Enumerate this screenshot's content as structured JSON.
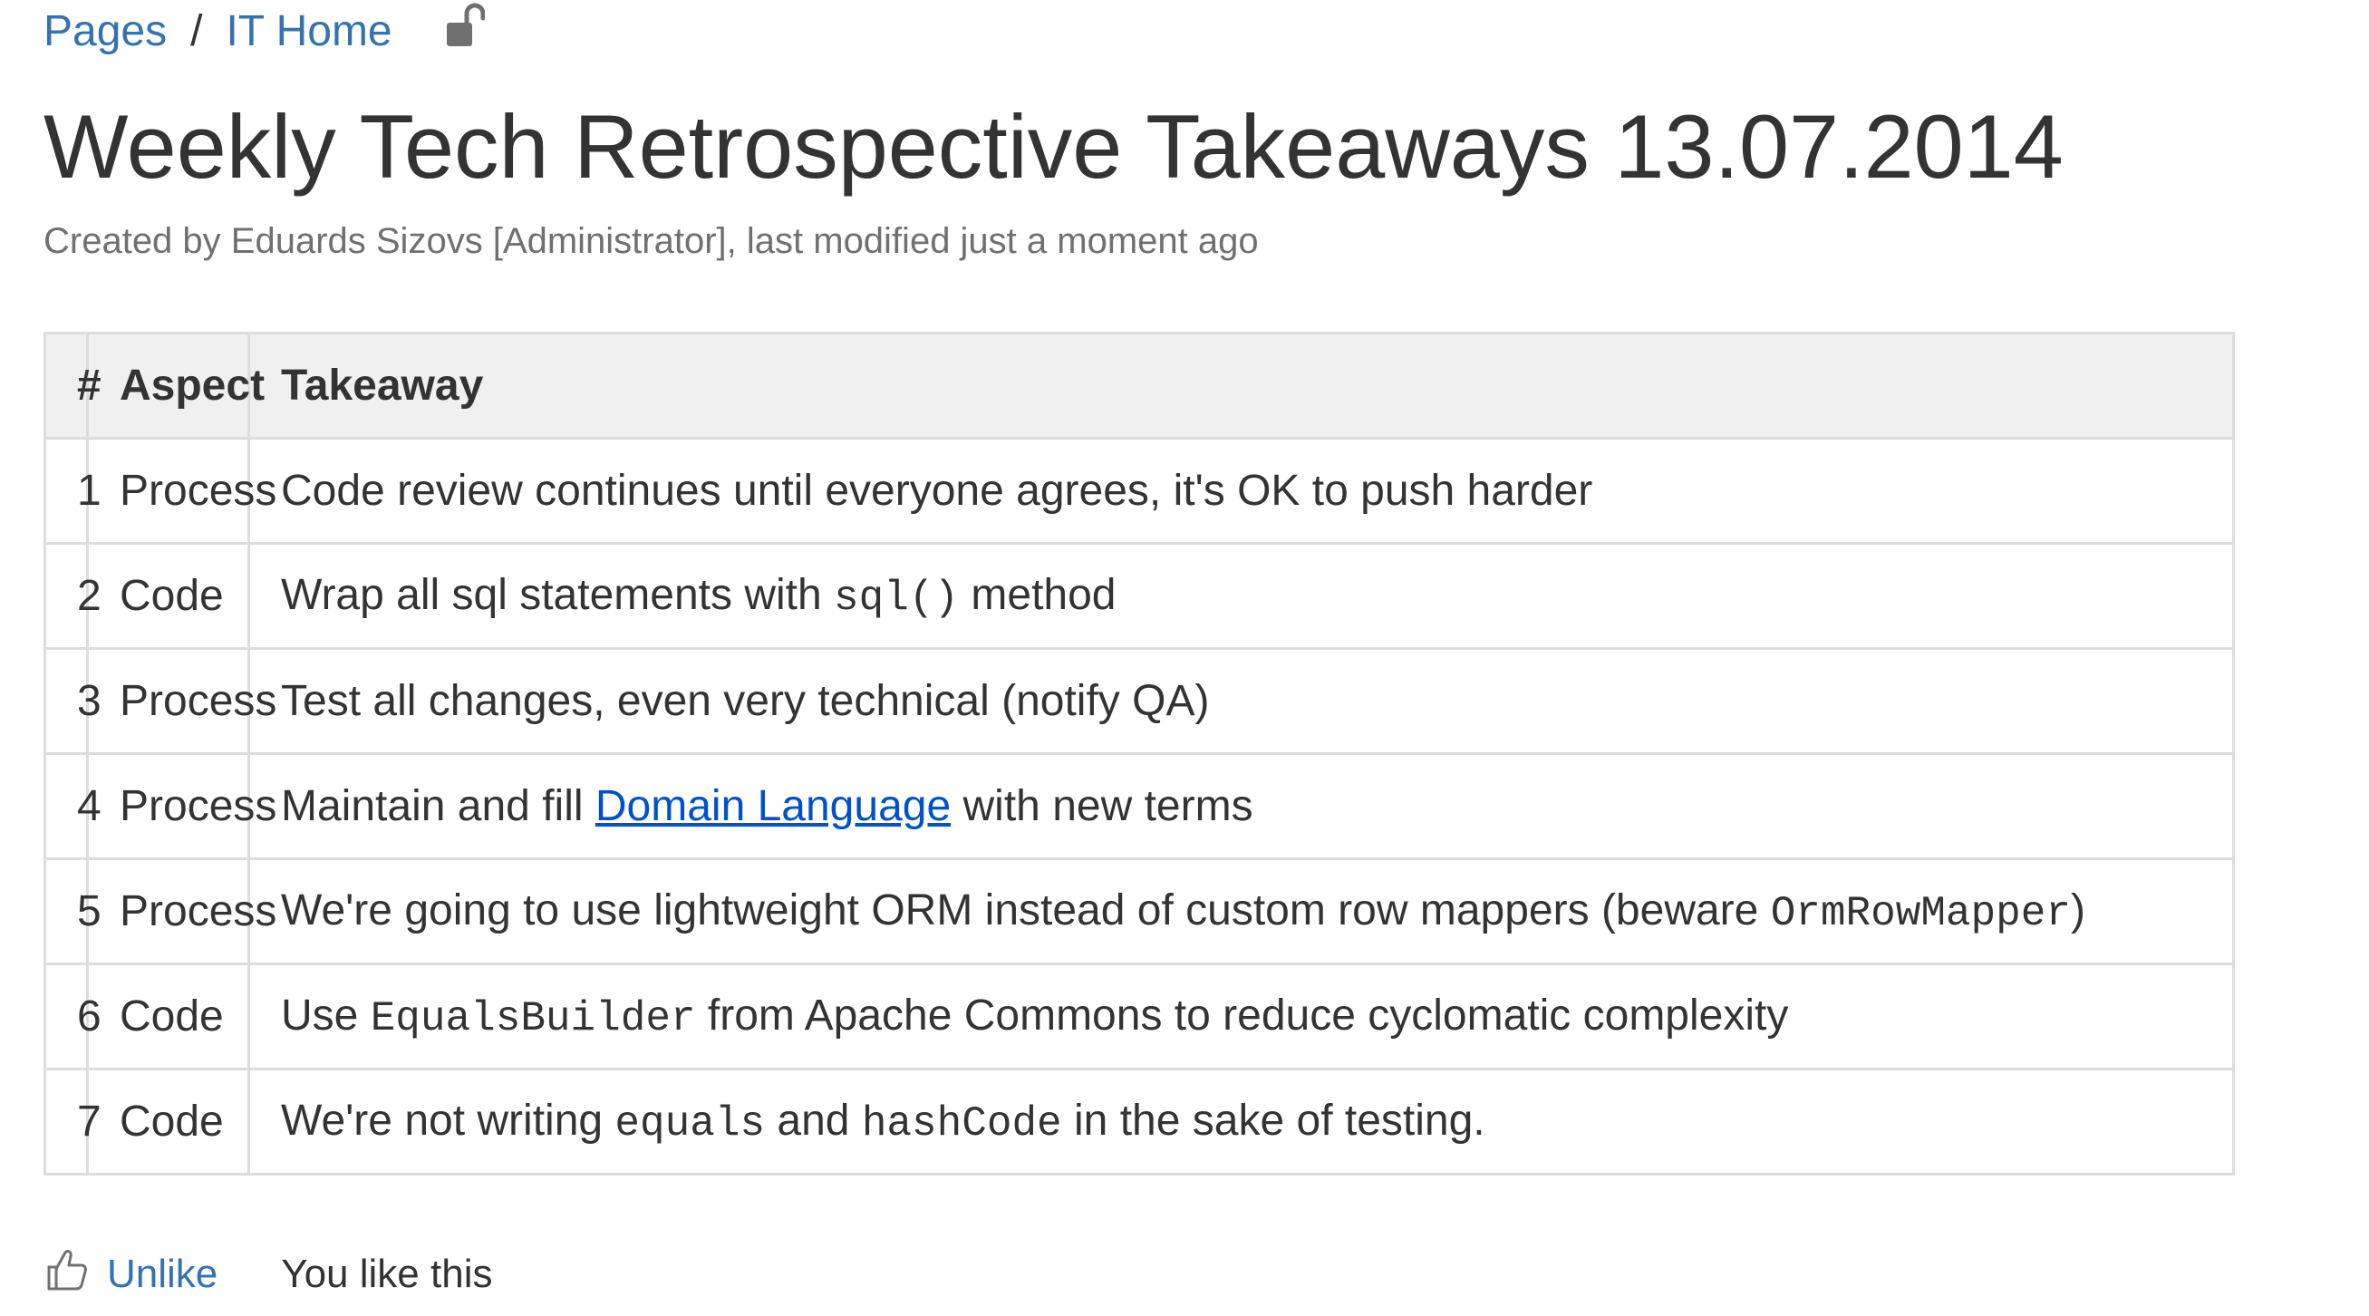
{
  "breadcrumb": {
    "items": [
      "Pages",
      "IT Home"
    ],
    "separator": "/"
  },
  "page": {
    "title": "Weekly Tech Retrospective Takeaways 13.07.2014",
    "meta": {
      "prefix": "Created by ",
      "author": "Eduards Sizovs [Administrator]",
      "suffix": ", last modified just a moment ago"
    }
  },
  "table": {
    "headers": [
      "#",
      "Aspect",
      "Takeaway"
    ],
    "rows": [
      {
        "num": "1",
        "aspect": "Process",
        "takeaway": [
          {
            "t": "text",
            "v": "Code review continues until everyone agrees, it's OK to push harder"
          }
        ]
      },
      {
        "num": "2",
        "aspect": "Code",
        "takeaway": [
          {
            "t": "text",
            "v": "Wrap all sql statements with "
          },
          {
            "t": "code",
            "v": "sql()"
          },
          {
            "t": "text",
            "v": " method"
          }
        ]
      },
      {
        "num": "3",
        "aspect": "Process",
        "takeaway": [
          {
            "t": "text",
            "v": "Test all changes, even very technical (notify QA)"
          }
        ]
      },
      {
        "num": "4",
        "aspect": "Process",
        "takeaway": [
          {
            "t": "text",
            "v": "Maintain and fill "
          },
          {
            "t": "link",
            "v": "Domain Language"
          },
          {
            "t": "text",
            "v": " with new terms"
          }
        ]
      },
      {
        "num": "5",
        "aspect": "Process",
        "takeaway": [
          {
            "t": "text",
            "v": "We're going to use lightweight ORM instead of custom row mappers (beware "
          },
          {
            "t": "code",
            "v": "OrmRowMapper"
          },
          {
            "t": "text",
            "v": ")"
          }
        ]
      },
      {
        "num": "6",
        "aspect": "Code",
        "takeaway": [
          {
            "t": "text",
            "v": "Use "
          },
          {
            "t": "code",
            "v": "EqualsBuilder"
          },
          {
            "t": "text",
            "v": " from Apache Commons to reduce cyclomatic complexity"
          }
        ]
      },
      {
        "num": "7",
        "aspect": "Code",
        "takeaway": [
          {
            "t": "text",
            "v": "We're not writing "
          },
          {
            "t": "code",
            "v": "equals"
          },
          {
            "t": "text",
            "v": " and "
          },
          {
            "t": "code",
            "v": "hashCode"
          },
          {
            "t": "text",
            "v": " in the sake of testing."
          }
        ]
      }
    ]
  },
  "like": {
    "button_label": "Unlike",
    "status": "You like this"
  },
  "icons": {
    "lock": "unlocked-padlock-icon",
    "like": "thumbs-up-icon"
  },
  "colors": {
    "link": "#3572b0",
    "inline_link": "#0052cc",
    "text": "#333333",
    "meta": "#707070",
    "table_border": "#dddddd",
    "table_header_bg": "#f0f0f0"
  }
}
